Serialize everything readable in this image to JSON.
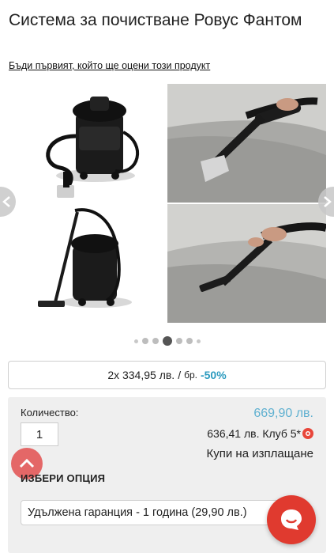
{
  "product": {
    "title": "Система за почистване Ровус Фантом",
    "rate_link": "Бъди първият, който ще оцени този продукт"
  },
  "gallery": {
    "images": [
      {
        "alt": "vacuum-with-upholstery-nozzle"
      },
      {
        "alt": "cleaning-sofa-upholstery"
      },
      {
        "alt": "vacuum-with-floor-nozzle"
      },
      {
        "alt": "vacuuming-sofa"
      }
    ],
    "dots_total": 7,
    "active_dot": 3
  },
  "pricing": {
    "installment_price": "2х 334,95 лв.",
    "separator": "/",
    "unit": "бр.",
    "discount": "-50%",
    "old_price": "669,90 лв.",
    "club_price": "636,41 лв. Клуб 5*",
    "installment_label": "Купи на изплащане"
  },
  "quantity": {
    "label": "Количество:",
    "value": "1"
  },
  "options": {
    "heading": "ИЗБЕРИ ОПЦИЯ",
    "selected": "Удължена гаранция - 1 година (29,90 лв.)"
  },
  "colors": {
    "accent_blue": "#2c9bbf",
    "accent_red": "#e03a2f"
  }
}
